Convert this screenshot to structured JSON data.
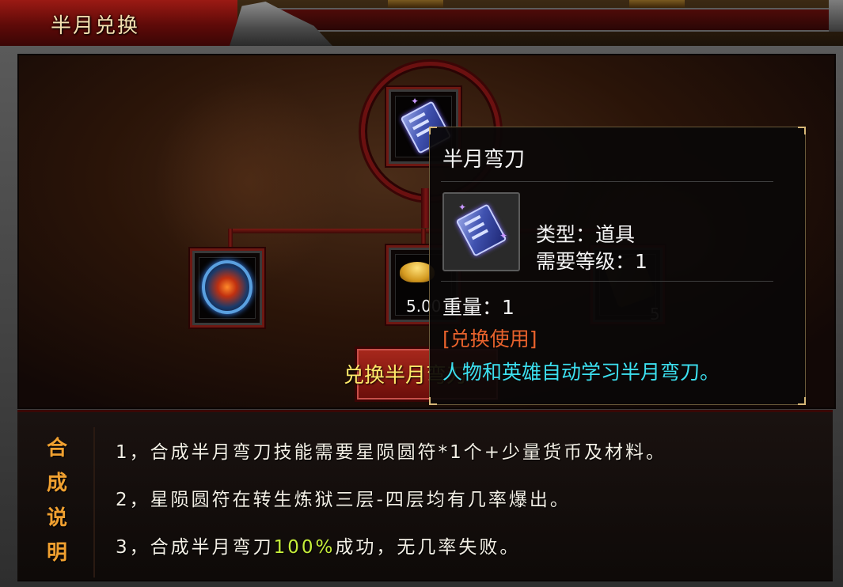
{
  "window": {
    "title": "半月兑换"
  },
  "slots": {
    "top_item": {
      "name": "半月弯刀",
      "icon": "skill-book-icon"
    },
    "materials": [
      {
        "icon": "rune-icon",
        "count": ""
      },
      {
        "icon": "gold-ingot-icon",
        "count": "5.00"
      },
      {
        "icon": "scroll-icon",
        "count": "5"
      }
    ]
  },
  "exchange_button": {
    "label": "兑换半月弯刀"
  },
  "tooltip": {
    "title": "半月弯刀",
    "type": "类型：道具",
    "level": "需要等级：1",
    "weight": "重量：1",
    "usage_tag": "[兑换使用]",
    "description": "人物和英雄自动学习半月弯刀。"
  },
  "description": {
    "label_chars": [
      "合",
      "成",
      "说",
      "明"
    ],
    "lines": [
      {
        "text": "1，合成半月弯刀技能需要星陨圆符*1个+少量货币及材料。"
      },
      {
        "prefix": "2，星陨圆符在转生炼狱三层-四层均有几率爆出。"
      },
      {
        "prefix": "3，合成半月弯刀",
        "highlight": "100%",
        "suffix": "成功，无几率失败。"
      }
    ]
  },
  "colors": {
    "title_text": "#f4e0b0",
    "button_text": "#ffe96a",
    "label": "#f0a030",
    "highlight": "#c6ee3a",
    "tooltip_usage": "#e8622c",
    "tooltip_desc": "#3ce0f0"
  }
}
